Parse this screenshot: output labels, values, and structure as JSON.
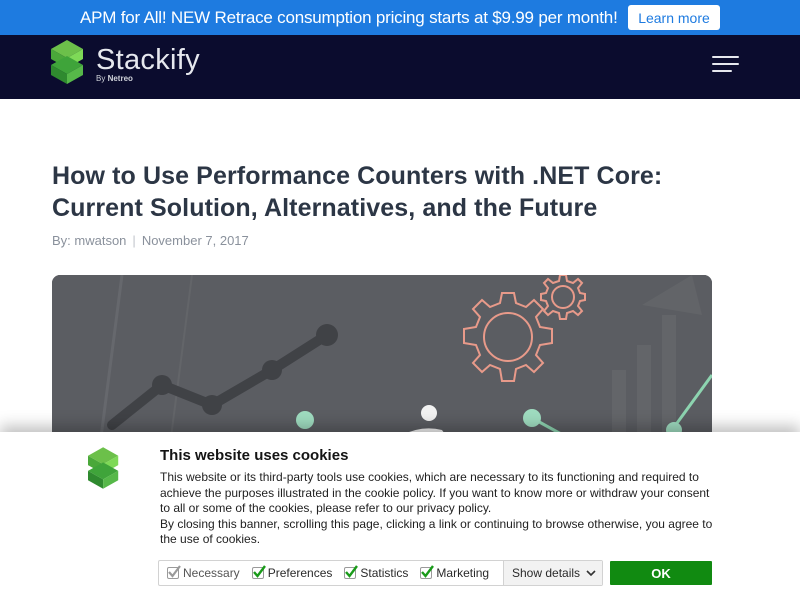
{
  "promo": {
    "text": "APM for All! NEW Retrace consumption pricing starts at $9.99 per month!",
    "button_label": "Learn more"
  },
  "nav": {
    "logo_text": "Stackify",
    "logo_by": "By",
    "logo_by_brand": "Netreo",
    "menu_icon": "hamburger-icon"
  },
  "article": {
    "title_line1": "How to Use Performance Counters with .NET Core:",
    "title_line2": "Current Solution, Alternatives, and the Future",
    "byline_author": "By: mwatson",
    "byline_date": "November 7, 2017"
  },
  "cookie_banner": {
    "title": "This website uses cookies",
    "paragraph1": "This website or its third-party tools use cookies, which are necessary to its functioning and required to achieve the purposes illustrated in the cookie policy. If you want to know more or withdraw your consent to all or some of the cookies, please refer to our privacy policy.",
    "paragraph2": "By closing this banner, scrolling this page, clicking a link or continuing to browse otherwise, you agree to the use of cookies.",
    "options": [
      {
        "label": "Necessary",
        "checked": true,
        "disabled": true
      },
      {
        "label": "Preferences",
        "checked": true,
        "disabled": false
      },
      {
        "label": "Statistics",
        "checked": true,
        "disabled": false
      },
      {
        "label": "Marketing",
        "checked": true,
        "disabled": false
      }
    ],
    "details_label": "Show details",
    "ok_label": "OK"
  },
  "colors": {
    "promo_bg": "#1e7be0",
    "nav_bg": "#0b0c2e",
    "logo_green": "#41b649",
    "ok_green": "#118a11",
    "check_green": "#1a9b1a"
  }
}
